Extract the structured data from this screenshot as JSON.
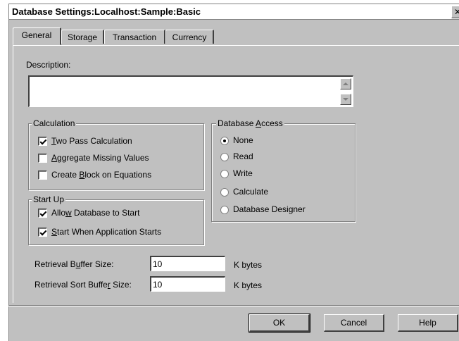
{
  "window": {
    "title": "Database Settings:Localhost:Sample:Basic",
    "close_label": "✕"
  },
  "tabs": [
    {
      "label": "General",
      "active": true
    },
    {
      "label": "Storage",
      "active": false
    },
    {
      "label": "Transaction",
      "active": false
    },
    {
      "label": "Currency",
      "active": false
    }
  ],
  "description": {
    "label": "Description:",
    "value": ""
  },
  "calculation": {
    "title": "Calculation",
    "options": [
      {
        "label_before": "",
        "hotkey": "T",
        "label_after": "wo Pass Calculation",
        "checked": true
      },
      {
        "label_before": "",
        "hotkey": "A",
        "label_after": "ggregate Missing Values",
        "checked": false
      },
      {
        "label_before": "Create ",
        "hotkey": "B",
        "label_after": "lock on Equations",
        "checked": false
      }
    ]
  },
  "startup": {
    "title": "Start Up",
    "options": [
      {
        "label_before": "Allo",
        "hotkey": "w",
        "label_after": " Database to Start",
        "checked": true
      },
      {
        "label_before": "",
        "hotkey": "S",
        "label_after": "tart When Application Starts",
        "checked": true
      }
    ]
  },
  "access": {
    "title_before": "Database ",
    "title_hotkey": "A",
    "title_after": "ccess",
    "options": [
      {
        "label": "None",
        "selected": true
      },
      {
        "label": "Read",
        "selected": false
      },
      {
        "label": "Write",
        "selected": false
      },
      {
        "label": "Calculate",
        "selected": false
      },
      {
        "label": "Database Designer",
        "selected": false
      }
    ]
  },
  "buffers": {
    "retrieval": {
      "label_before": "Retrieval B",
      "hotkey": "u",
      "label_after": "ffer Size:",
      "value": "10",
      "unit": "K bytes"
    },
    "sort": {
      "label_before": "Retrieval Sort Buffe",
      "hotkey": "r",
      "label_after": " Size:",
      "value": "10",
      "unit": "K bytes"
    }
  },
  "buttons": {
    "ok": "OK",
    "cancel": "Cancel",
    "help": "Help"
  },
  "colors": {
    "face": "#c0c0c0",
    "highlight": "#ffffff",
    "shadow": "#808080",
    "dark": "#404040"
  }
}
